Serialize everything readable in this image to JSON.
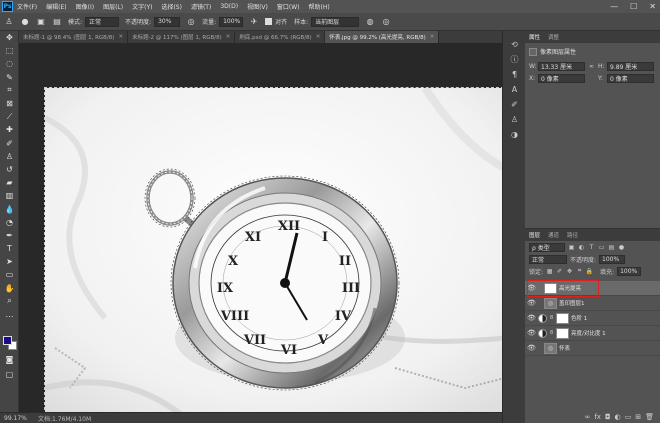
{
  "menu": {
    "logo": "Ps",
    "items": [
      "文件(F)",
      "编辑(E)",
      "图像(I)",
      "图层(L)",
      "文字(Y)",
      "选择(S)",
      "滤镜(T)",
      "3D(D)",
      "视图(V)",
      "窗口(W)",
      "帮助(H)"
    ],
    "controls": {
      "minimize": "—",
      "maximize": "☐",
      "close": "✕"
    }
  },
  "options": {
    "mode_label": "模式:",
    "mode_value": "正常",
    "opacity_label": "不透明度:",
    "opacity_value": "30%",
    "flow_label": "流量:",
    "flow_value": "100%",
    "align_label": "对齐",
    "sample_label": "样本:",
    "sample_value": "当前图层"
  },
  "tabs": [
    {
      "label": "未标题-1 @ 98.4% (图层 1, RGB/8)",
      "active": false
    },
    {
      "label": "未标题-2 @ 117% (图层 1, RGB/8)",
      "active": false
    },
    {
      "label": "刷底.psd @ 66.7% (RGB/8)",
      "active": false
    },
    {
      "label": "怀表.jpg @ 99.2% (高光提亮, RGB/8)",
      "active": true
    }
  ],
  "tab_close": "✕",
  "status": {
    "zoom": "99.17%",
    "doc": "文档:1.76M/4.10M"
  },
  "properties": {
    "tabs": [
      "属性",
      "调整"
    ],
    "header": "像素图层属性",
    "w_label": "W:",
    "w_value": "13.33 厘米",
    "h_label": "H:",
    "h_value": "9.89 厘米",
    "x_label": "X:",
    "x_value": "0 像素",
    "y_label": "Y:",
    "y_value": "0 像素"
  },
  "layers": {
    "tabs": [
      "图层",
      "通道",
      "路径"
    ],
    "filter_value": "ρ 类型",
    "blend_mode": "正常",
    "opacity_label": "不透明度:",
    "opacity_value": "100%",
    "lock_label": "锁定:",
    "fill_label": "填充:",
    "fill_value": "100%",
    "items": [
      {
        "name": "高光提亮",
        "kind": "pixel",
        "active": true,
        "chain": ""
      },
      {
        "name": "盖印图层1",
        "kind": "group",
        "active": false,
        "chain": ""
      },
      {
        "name": "色阶 1",
        "kind": "adjust",
        "active": false,
        "chain": "8"
      },
      {
        "name": "亮度/对比度 1",
        "kind": "adjust",
        "active": false,
        "chain": "8"
      },
      {
        "name": "怀表",
        "kind": "group",
        "active": false,
        "chain": ""
      }
    ],
    "footer_icons": [
      "∞",
      "fx",
      "◘",
      "◐",
      "▭",
      "⊞",
      "🗑"
    ]
  },
  "colors": {
    "foreground": "#1a0b8c",
    "background": "#ffffff",
    "selection_highlight": "#e0201a"
  }
}
